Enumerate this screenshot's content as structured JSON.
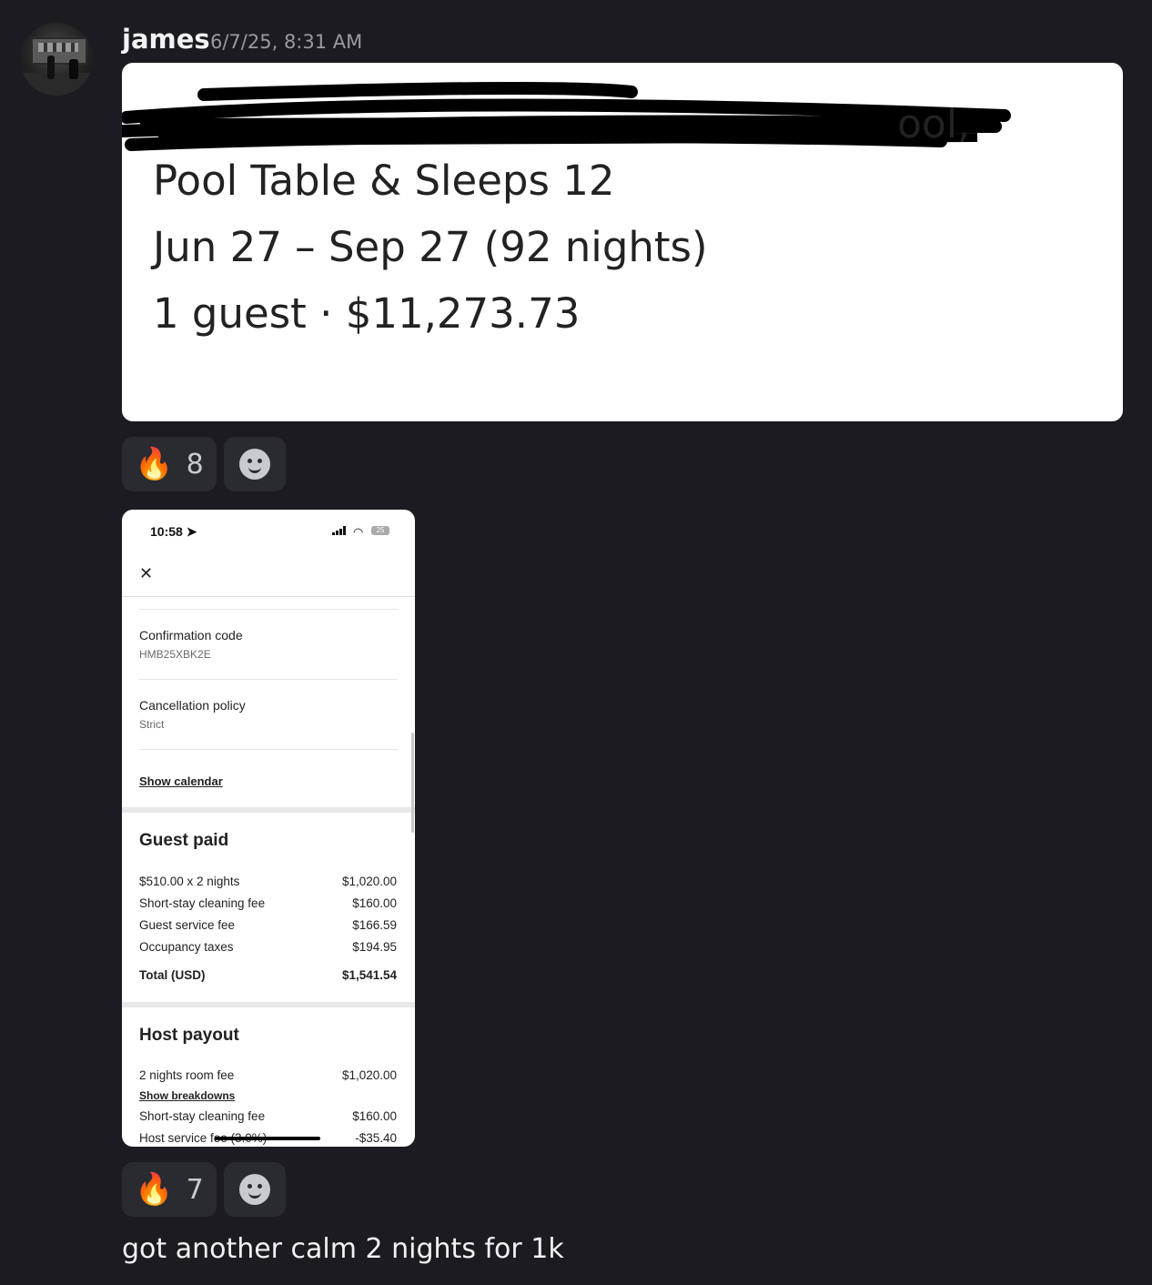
{
  "message": {
    "author": "james",
    "timestamp": "6/7/25, 8:31 AM",
    "text": "got another calm 2 nights for 1k"
  },
  "attachment1": {
    "line1": "Pool Table & Sleeps 12",
    "line2": "Jun 27 – Sep 27 (92 nights)",
    "line3": "1 guest · $11,273.73"
  },
  "reactions1": {
    "emoji": "🔥",
    "count": "8"
  },
  "reactions2": {
    "emoji": "🔥",
    "count": "7"
  },
  "phone": {
    "status_time": "10:58",
    "battery": "25",
    "confirmation_label": "Confirmation code",
    "confirmation_value": "HMB25XBK2E",
    "cancellation_label": "Cancellation policy",
    "cancellation_value": "Strict",
    "show_calendar": "Show calendar",
    "guest_paid_title": "Guest paid",
    "guest_paid_rows": [
      {
        "label": "$510.00 x 2 nights",
        "value": "$1,020.00"
      },
      {
        "label": "Short-stay cleaning fee",
        "value": "$160.00"
      },
      {
        "label": "Guest service fee",
        "value": "$166.59"
      },
      {
        "label": "Occupancy taxes",
        "value": "$194.95"
      }
    ],
    "total_label": "Total (USD)",
    "total_value": "$1,541.54",
    "host_payout_title": "Host payout",
    "host_rows": [
      {
        "label": "2 nights room fee",
        "value": "$1,020.00"
      },
      {
        "label": "Short-stay cleaning fee",
        "value": "$160.00"
      },
      {
        "label": "Host service fee (3.0%)",
        "value": "-$35.40"
      }
    ],
    "show_breakdowns": "Show breakdowns"
  }
}
